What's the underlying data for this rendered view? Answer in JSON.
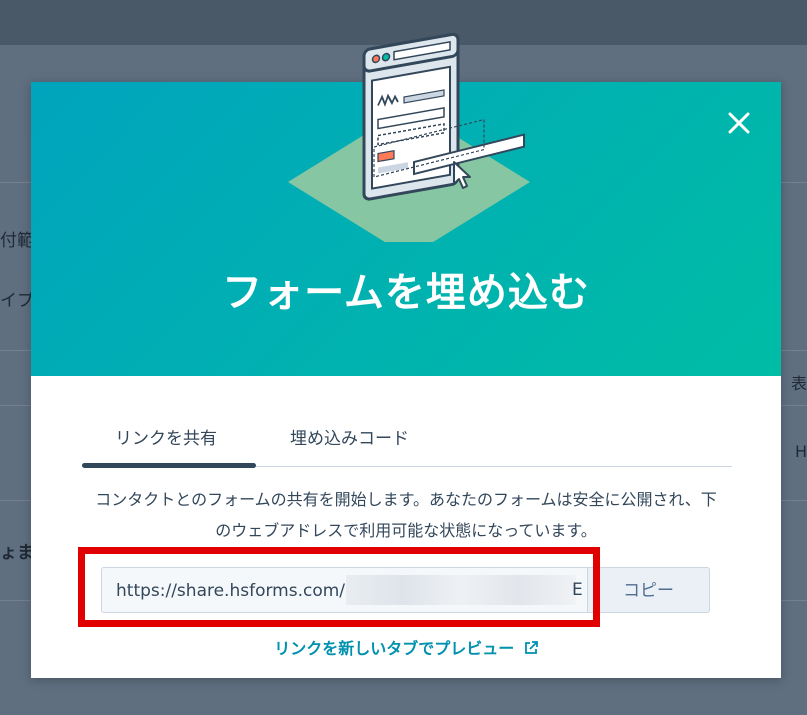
{
  "background": {
    "left_labels": [
      "付範",
      "イプ",
      "ょま"
    ],
    "right_labels": [
      "表",
      "H"
    ]
  },
  "modal": {
    "title": "フォームを埋め込む",
    "close_icon": "close-icon",
    "tabs": [
      {
        "label": "リンクを共有",
        "active": true
      },
      {
        "label": "埋め込みコード",
        "active": false
      }
    ],
    "description": "コンタクトとのフォームの共有を開始します。あなたのフォームは安全に公開され、下のウェブアドレスで利用可能な状態になっています。",
    "share_url_visible": "https://share.hsforms.com/1M",
    "share_url_tail": "E",
    "copy_label": "コピー",
    "preview_link": "リンクを新しいタブでプレビュー",
    "preview_icon": "external-link-icon"
  },
  "colors": {
    "header_gradient_start": "#00a4bd",
    "header_gradient_end": "#00bda5",
    "highlight": "#e00000",
    "link": "#0091ae"
  }
}
